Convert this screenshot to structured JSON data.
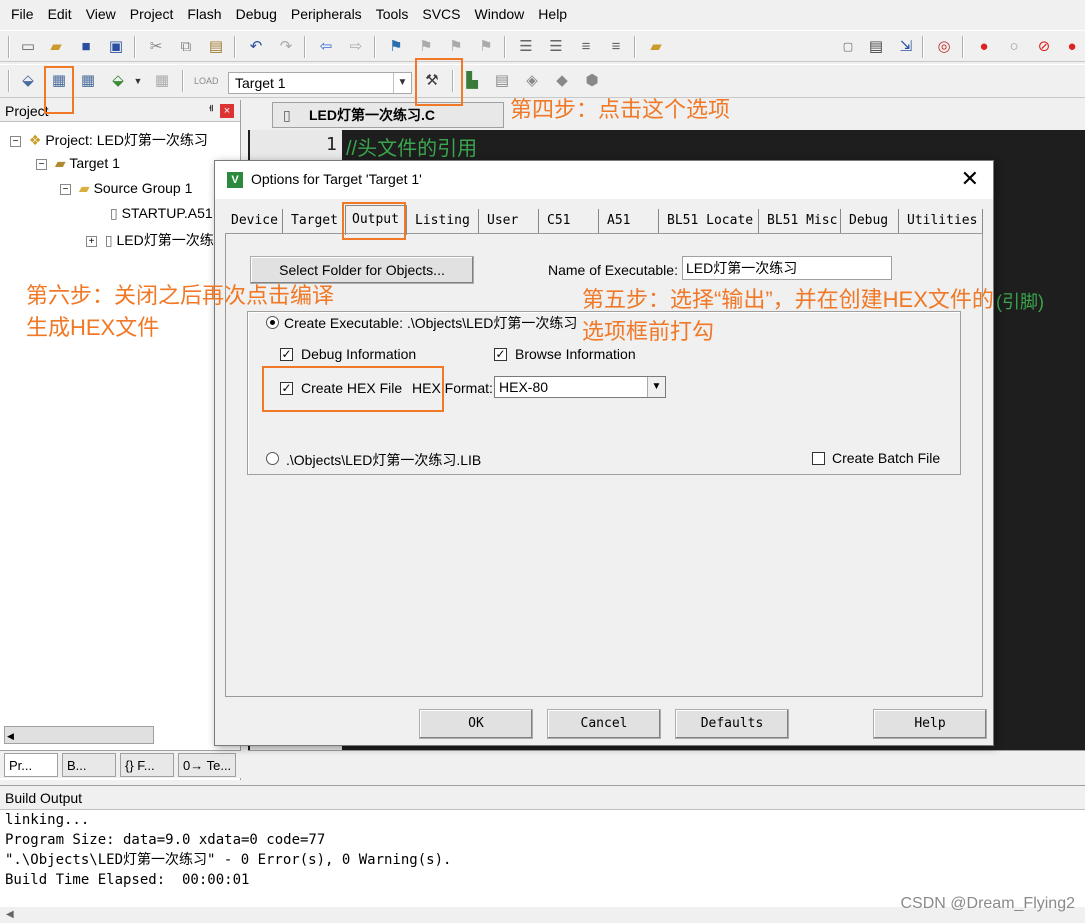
{
  "menu": [
    "File",
    "Edit",
    "View",
    "Project",
    "Flash",
    "Debug",
    "Peripherals",
    "Tools",
    "SVCS",
    "Window",
    "Help"
  ],
  "toolbar2": {
    "target_value": "Target 1"
  },
  "project_panel": {
    "title": "Project",
    "pin": "ᅦ",
    "close": "×",
    "tree": {
      "project": "Project: LED灯第一次练习",
      "target": "Target 1",
      "group": "Source Group 1",
      "file1": "STARTUP.A51",
      "file2": "LED灯第一次练习.C"
    },
    "tabs": [
      "Pr...",
      "B...",
      "{} F...",
      "0→ Te..."
    ]
  },
  "editor": {
    "tab_label": "LED灯第一次练习.C",
    "line_number": "1",
    "comment": "//头文件的引用",
    "right_fragment": "(引脚)"
  },
  "dialog": {
    "title": "Options for Target 'Target 1'",
    "tabs": [
      "Device",
      "Target",
      "Output",
      "Listing",
      "User",
      "C51",
      "A51",
      "BL51 Locate",
      "BL51 Misc",
      "Debug",
      "Utilities"
    ],
    "active_tab": "Output",
    "select_folder_label": "Select Folder for Objects...",
    "name_exec_label": "Name of Executable:",
    "name_exec_value": "LED灯第一次练习",
    "create_exec_label": "Create Executable:  .\\Objects\\LED灯第一次练习",
    "debug_info_label": "Debug Information",
    "browse_info_label": "Browse Information",
    "create_hex_label": "Create HEX File",
    "hex_format_label": "HEX Format:",
    "hex_format_value": "HEX-80",
    "lib_label": ".\\Objects\\LED灯第一次练习.LIB",
    "create_batch_label": "Create Batch File",
    "buttons": {
      "ok": "OK",
      "cancel": "Cancel",
      "defaults": "Defaults",
      "help": "Help"
    },
    "checks": {
      "create_executable": true,
      "debug_info": true,
      "browse_info": true,
      "create_hex": true,
      "create_lib": false,
      "create_batch": false
    }
  },
  "build_output": {
    "title": "Build Output",
    "lines": [
      "linking...",
      "Program Size: data=9.0 xdata=0 code=77",
      "\".\\Objects\\LED灯第一次练习\" - 0 Error(s), 0 Warning(s).",
      "Build Time Elapsed:  00:00:01"
    ]
  },
  "annotations": {
    "step4": "第四步：点击这个选项",
    "step5_line1": "第五步：选择“输出”，并在创建HEX文件的",
    "step5_line2": "选项框前打勾",
    "step6_line1": "第六步：关闭之后再次点击编译",
    "step6_line2": "生成HEX文件"
  },
  "watermark": "CSDN @Dream_Flying2",
  "colors": {
    "annotation": "#f07826",
    "editor_bg": "#1e1e1e",
    "comment": "#3aa64e"
  }
}
